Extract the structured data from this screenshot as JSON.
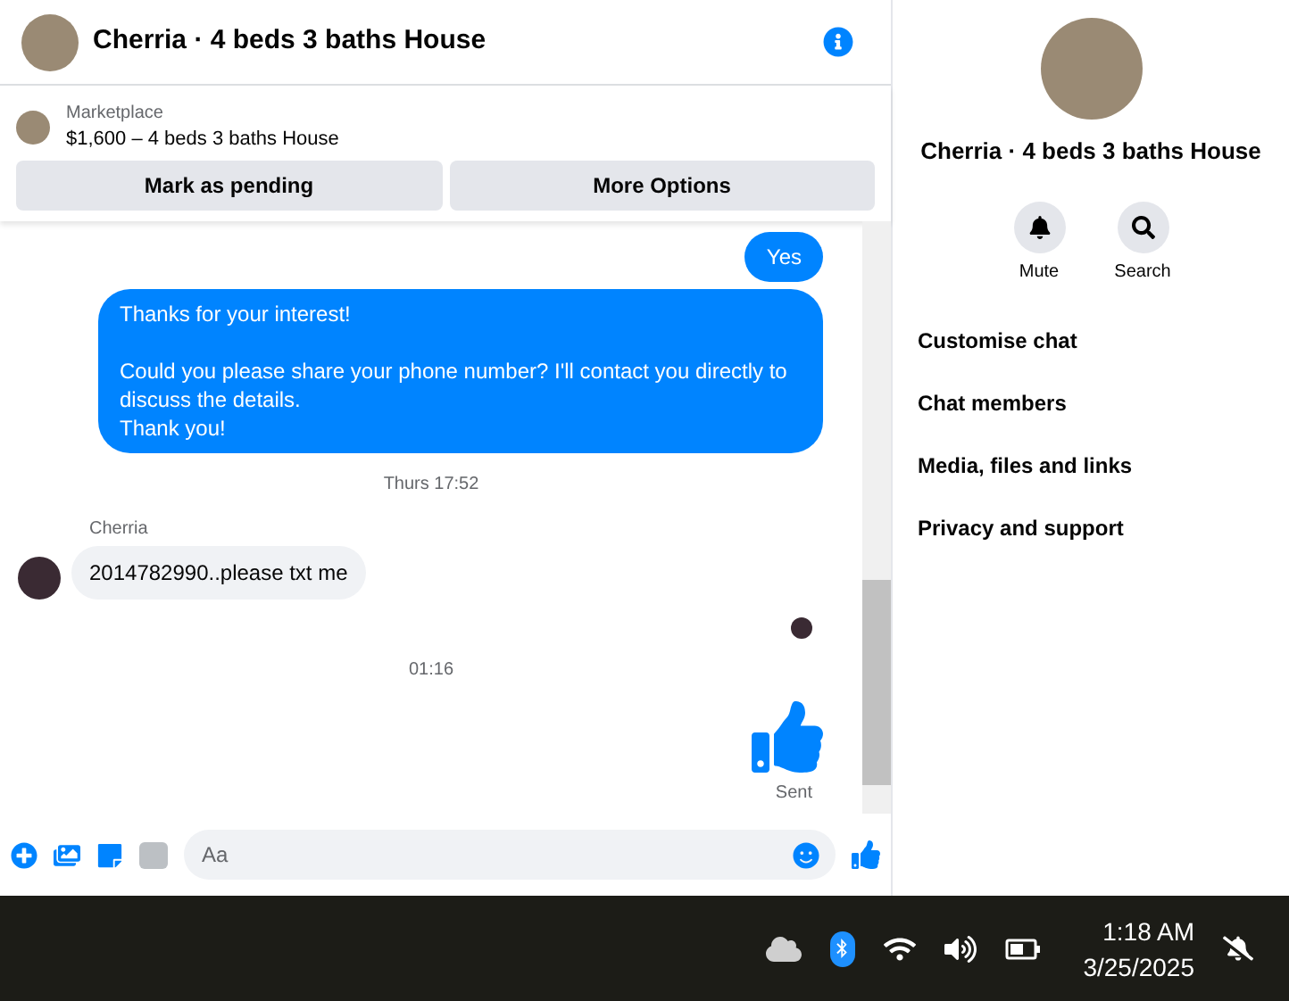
{
  "header": {
    "title": "Cherria · 4 beds 3 baths House"
  },
  "listing": {
    "source": "Marketplace",
    "title": "$1,600 – 4 beds 3 baths House",
    "buttons": [
      "Mark as pending",
      "More Options"
    ]
  },
  "messages": [
    {
      "kind": "outgoing",
      "text": "Yes"
    },
    {
      "kind": "outgoing",
      "text": "Thanks for your interest!\n\nCould you please share your phone number? I'll contact you directly to discuss the details.\nThank you!"
    },
    {
      "kind": "timestamp",
      "text": "Thurs 17:52"
    },
    {
      "kind": "incoming",
      "sender": "Cherria",
      "text": "2014782990..please txt me"
    },
    {
      "kind": "seen"
    },
    {
      "kind": "timestamp",
      "text": "01:16"
    },
    {
      "kind": "like",
      "status": "Sent"
    }
  ],
  "composer": {
    "placeholder": "Aa"
  },
  "details": {
    "title": "Cherria · 4 beds 3 baths House",
    "actions": [
      "Mute",
      "Search"
    ],
    "items": [
      "Customise chat",
      "Chat members",
      "Media, files and links",
      "Privacy and support"
    ]
  },
  "taskbar": {
    "time": "1:18 AM",
    "date": "3/25/2025"
  }
}
